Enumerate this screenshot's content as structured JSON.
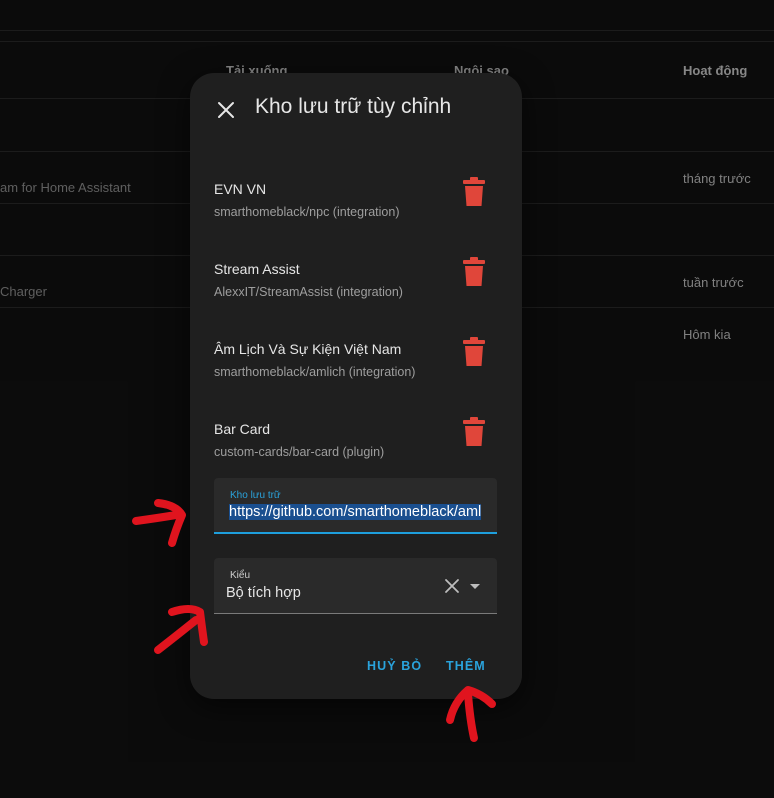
{
  "background": {
    "headers": {
      "downloads": "Tải xuống",
      "stars": "Ngôi sao",
      "activity": "Hoạt động"
    },
    "rows": [
      {
        "name_fragment": "am for Home Assistant",
        "activity": "tháng trước"
      },
      {
        "name_fragment": "Charger",
        "activity": "tuần trước"
      },
      {
        "name_fragment": "",
        "activity": "Hôm kia"
      }
    ]
  },
  "dialog": {
    "title": "Kho lưu trữ tùy chỉnh",
    "close_icon": "close-icon",
    "repositories": [
      {
        "name": "EVN VN",
        "path": "smarthomeblack/npc (integration)"
      },
      {
        "name": "Stream Assist",
        "path": "AlexxIT/StreamAssist (integration)"
      },
      {
        "name": "Âm Lịch Và Sự Kiện Việt Nam",
        "path": "smarthomeblack/amlich (integration)"
      },
      {
        "name": "Bar Card",
        "path": "custom-cards/bar-card (plugin)"
      }
    ],
    "repository_field": {
      "label": "Kho lưu trữ",
      "value": "https://github.com/smarthomeblack/amlich"
    },
    "type_field": {
      "label": "Kiểu",
      "value": "Bộ tích hợp"
    },
    "cancel_label": "HUỶ BỎ",
    "add_label": "THÊM"
  },
  "colors": {
    "accent": "#2aa3dc",
    "delete": "#e0463a",
    "dialog_bg": "#1f1f1f",
    "annotation": "#e0141e"
  }
}
